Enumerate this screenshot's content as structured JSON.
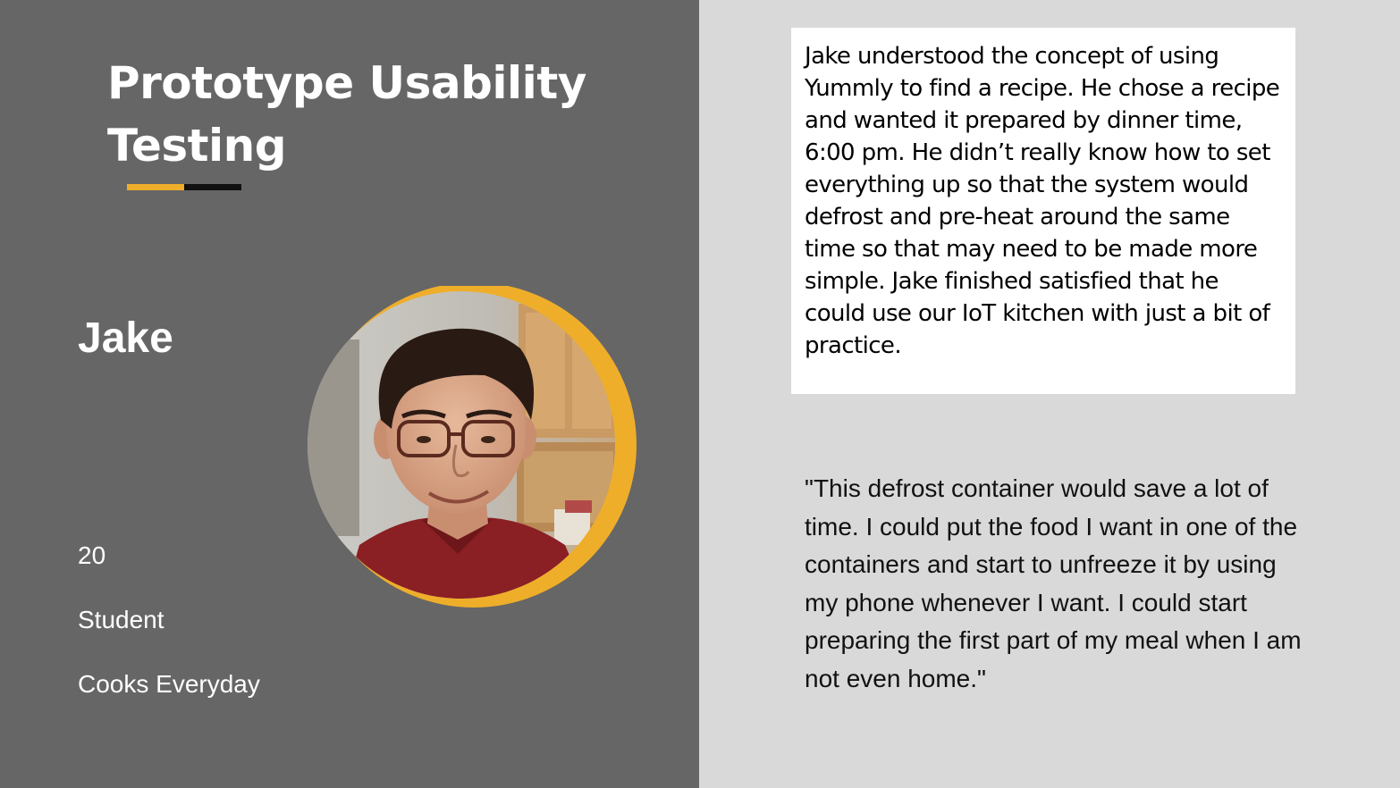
{
  "slide": {
    "title": "Prototype Usability Testing",
    "colors": {
      "left_background": "#666666",
      "right_background": "#d9d9d9",
      "accent_yellow": "#efae2a",
      "accent_black": "#111111",
      "card_background": "#ffffff"
    }
  },
  "persona": {
    "name": "Jake",
    "age": "20",
    "occupation": "Student",
    "habit": "Cooks Everyday",
    "photo_icon": "portrait-photo"
  },
  "summary": {
    "text": "Jake understood the concept of using Yummly to find a recipe. He chose a recipe and wanted it prepared by dinner time, 6:00 pm. He didn’t really know how to set everything up so that the system would defrost and pre-heat around the same time so that may need to be made more simple. Jake finished satisfied that he could use our IoT kitchen with just a bit of practice."
  },
  "quote": {
    "text": "\"This defrost container would save a lot of time. I could put the food I want in one of the containers and start to unfreeze it by using my phone whenever I want. I could start preparing the first part of my meal when I am not even home.\""
  }
}
